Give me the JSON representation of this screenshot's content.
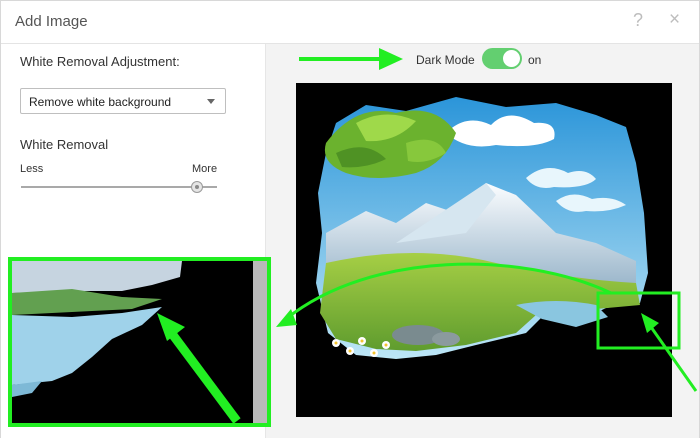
{
  "dialog": {
    "title": "Add Image",
    "help_symbol": "?",
    "close_symbol": "×"
  },
  "left_panel": {
    "adjustment_label": "White Removal Adjustment:",
    "select_value": "Remove white background",
    "removal_label": "White Removal",
    "less_label": "Less",
    "more_label": "More",
    "slider_value": 0.9
  },
  "dark_mode": {
    "label": "Dark Mode",
    "state": "on"
  },
  "colors": {
    "accent": "#22ee22",
    "toggle": "#63cf70"
  },
  "icons": {
    "help": "help-icon",
    "close": "close-icon",
    "dropdown": "chevron-down-icon"
  }
}
